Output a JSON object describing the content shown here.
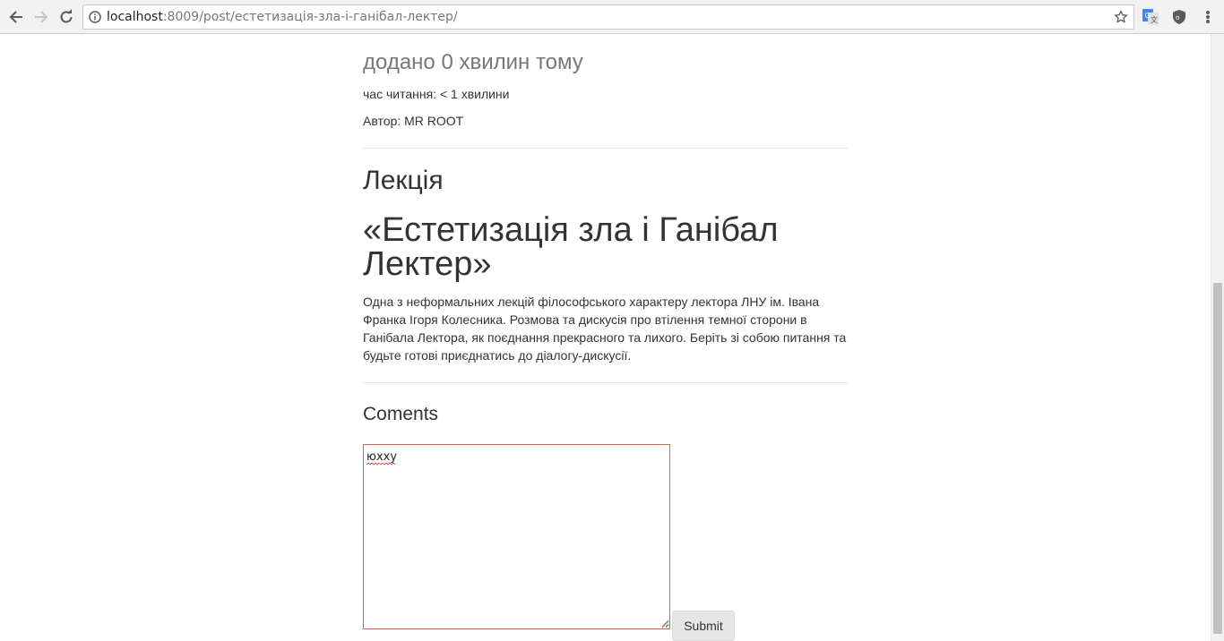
{
  "browser": {
    "url_host": "localhost",
    "url_rest": ":8009/post/естетизація-зла-і-ганібал-лектер/",
    "back_icon": "arrow-left-icon",
    "forward_icon": "arrow-right-icon",
    "reload_icon": "reload-icon",
    "info_icon": "info-icon",
    "star_icon": "star-icon",
    "extensions": [
      "google-translate-icon",
      "ublock-icon"
    ],
    "menu_icon": "kebab-menu-icon"
  },
  "post": {
    "added": "додано 0 хвилин тому",
    "read_time": "час читання: < 1 хвилини",
    "author": "Автор: MR ROOT",
    "kind": "Лекція",
    "title": "«Естетизація зла і Ганібал Лектер»",
    "description": "Одна з неформальних лекцій філософського характеру лектора ЛНУ ім. Івана Франка Ігоря Колесника. Розмова та дискусія про втілення темної сторони в Ганібала Лектора, як поєднання прекрасного та лихого. Беріть зі собою питання та будьте готові приєднатись до діалогу-дискусії."
  },
  "comments": {
    "heading": "Coments",
    "textarea_value": "юхху",
    "submit_label": "Submit"
  },
  "colors": {
    "textarea_border": "#e0604f",
    "muted_text": "#777777",
    "body_text": "#333333"
  }
}
